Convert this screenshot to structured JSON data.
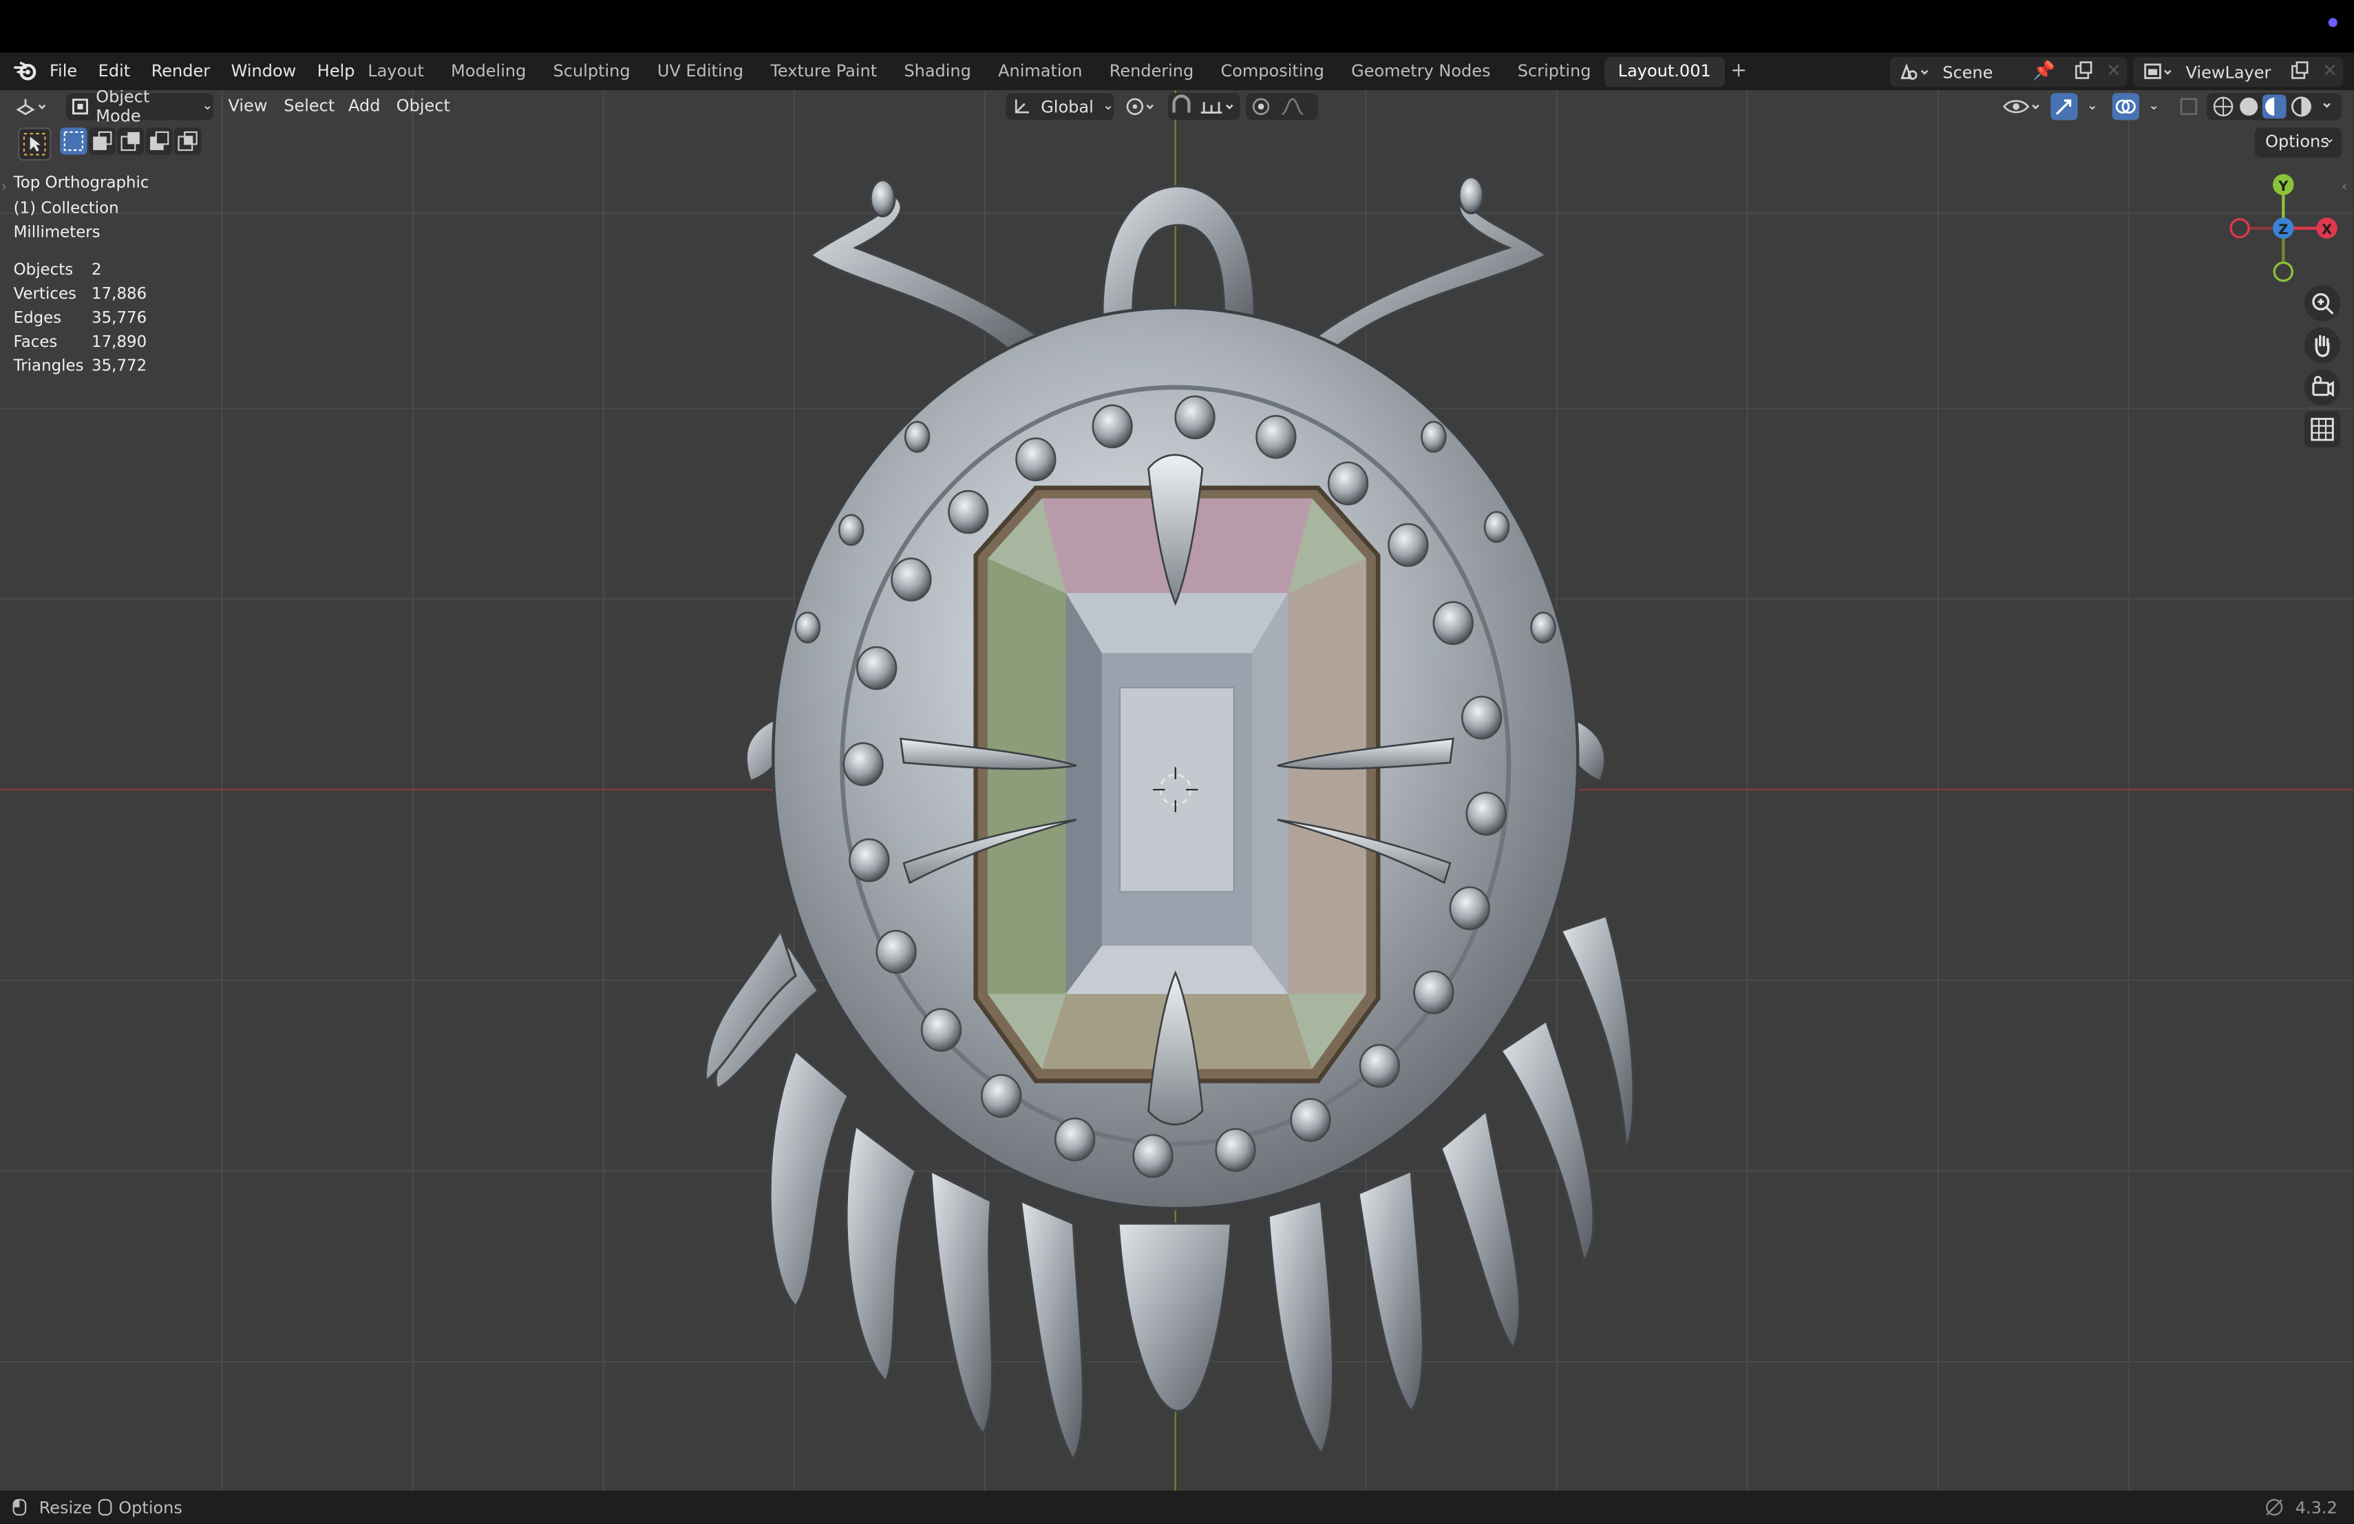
{
  "menubar": {
    "menus": [
      "File",
      "Edit",
      "Render",
      "Window",
      "Help"
    ],
    "workspaces": [
      "Layout",
      "Modeling",
      "Sculpting",
      "UV Editing",
      "Texture Paint",
      "Shading",
      "Animation",
      "Rendering",
      "Compositing",
      "Geometry Nodes",
      "Scripting",
      "Layout.001"
    ],
    "active_workspace": "Layout.001",
    "add_tab": "+",
    "scene_name": "Scene",
    "view_layer": "ViewLayer"
  },
  "viewport_header": {
    "mode": "Object Mode",
    "menus": [
      "View",
      "Select",
      "Add",
      "Object"
    ],
    "orientation": "Global",
    "options": "Options"
  },
  "overlay": {
    "view_name": "Top Orthographic",
    "collection": "(1) Collection",
    "units": "Millimeters"
  },
  "stats": [
    {
      "label": "Objects",
      "value": "2"
    },
    {
      "label": "Vertices",
      "value": "17,886"
    },
    {
      "label": "Edges",
      "value": "35,776"
    },
    {
      "label": "Faces",
      "value": "17,890"
    },
    {
      "label": "Triangles",
      "value": "35,772"
    }
  ],
  "gizmo": {
    "y": "Y",
    "z": "Z",
    "x": "X"
  },
  "statusbar": {
    "resize": "Resize",
    "options": "Options",
    "version": "4.3.2"
  },
  "colors": {
    "x_axis": "#e0394e",
    "y_axis": "#8bc33a",
    "z_axis": "#3b82d6",
    "grid_bg": "#3d3d3d",
    "accent": "#4772b3"
  }
}
